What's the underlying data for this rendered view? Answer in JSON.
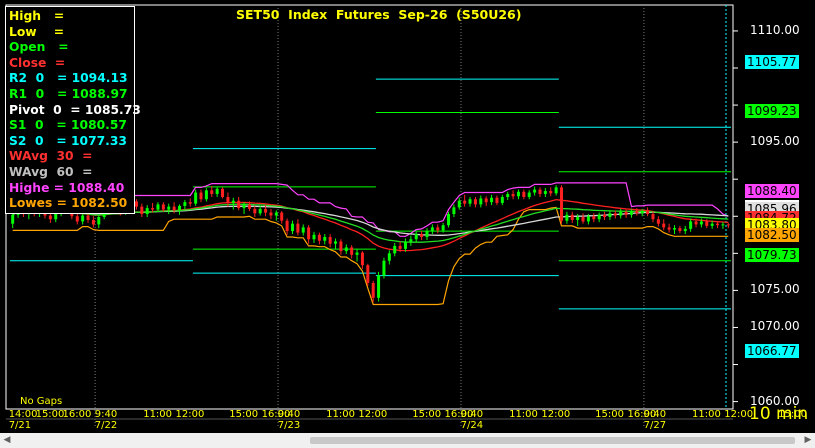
{
  "title": "SET50  Index  Futures  Sep-26  (S50U26)",
  "legend": [
    {
      "label": "High   =",
      "color": "#ffff00"
    },
    {
      "label": "Low    =",
      "color": "#ffff00"
    },
    {
      "label": "Open   =",
      "color": "#00ff00"
    },
    {
      "label": "Close  =",
      "color": "#ff3030"
    },
    {
      "label": "R2  0   = 1094.13",
      "color": "#00ffff"
    },
    {
      "label": "R1  0   = 1088.97",
      "color": "#00ff00"
    },
    {
      "label": "Pivot  0  = 1085.73",
      "color": "#ffffff"
    },
    {
      "label": "S1  0   = 1080.57",
      "color": "#00ff00"
    },
    {
      "label": "S2  0   = 1077.33",
      "color": "#00ffff"
    },
    {
      "label": "WAvg  30  =",
      "color": "#ff3030"
    },
    {
      "label": "WAvg  60  =",
      "color": "#c0c0c0"
    },
    {
      "label": "Highe = 1088.40",
      "color": "#ff44ff"
    },
    {
      "label": "Lowes = 1082.50",
      "color": "#ffa500"
    }
  ],
  "status": {
    "gaps": "No Gaps",
    "interval": "10  min"
  },
  "badges": [
    {
      "label": "1105.77",
      "value": 1105.77,
      "color": "#00ffff"
    },
    {
      "label": "1099.23",
      "value": 1099.23,
      "color": "#00ff00"
    },
    {
      "label": "1088.40",
      "value": 1088.4,
      "color": "#ff44ff"
    },
    {
      "label": "1086.27",
      "value": 1086.27,
      "color": "#ffffff"
    },
    {
      "label": "1085.96",
      "value": 1085.96,
      "color": "#e0e0e0"
    },
    {
      "label": "1084.72",
      "value": 1084.72,
      "color": "#ff3030"
    },
    {
      "label": "1083.80",
      "value": 1083.8,
      "color": "#ffff00"
    },
    {
      "label": "1082.50",
      "value": 1082.5,
      "color": "#ffa500"
    },
    {
      "label": "1079.73",
      "value": 1079.73,
      "color": "#00ff00"
    },
    {
      "label": "1066.77",
      "value": 1066.77,
      "color": "#00ffff"
    }
  ],
  "chart_data": {
    "type": "candlestick",
    "ylim": [
      1059,
      1113.5
    ],
    "yticks": [
      1060,
      1065,
      1070,
      1075,
      1080,
      1085,
      1090,
      1095,
      1100,
      1105,
      1110
    ],
    "ytick_labels": [
      "1060.00",
      "",
      "1070.00",
      "1075.00",
      "",
      "",
      "",
      "1095.00",
      "",
      "",
      "1110.00"
    ],
    "bars_per_day": 34,
    "days": [
      "7/21",
      "7/22",
      "7/23",
      "7/24",
      "7/27"
    ],
    "time_labels": [
      "14:00",
      "15:00",
      "16:00",
      "9:40",
      "11:00",
      "12:00",
      "15:00",
      "16:00",
      "9:40",
      "11:00",
      "12:00",
      "15:00",
      "16:00",
      "9:40",
      "11:00",
      "12:00",
      "15:00",
      "16:00",
      "9:40",
      "11:00",
      "12:00",
      "15:00"
    ],
    "time_label_bars": [
      0,
      5,
      10,
      16,
      25,
      31,
      41,
      47,
      50,
      59,
      65,
      75,
      81,
      84,
      93,
      99,
      109,
      115,
      118,
      127,
      133,
      143
    ],
    "date_label_bars": [
      0,
      16,
      50,
      84,
      118
    ],
    "pivot_levels": [
      {
        "name": "R2",
        "color": "#00ffff",
        "segments": [
          [
            null,
            1094.13
          ],
          [
            1094.13,
            1104.0
          ],
          [
            1103.5,
            1097.0
          ],
          [
            1097.0,
            1105.77
          ]
        ]
      },
      {
        "name": "R1",
        "color": "#00ff00",
        "segments": [
          [
            null,
            1088.97
          ],
          [
            1088.97,
            1099.0
          ],
          [
            1099.0,
            1091.0
          ],
          [
            1091.0,
            1099.23
          ]
        ]
      },
      {
        "name": "S1",
        "color": "#00ff00",
        "segments": [
          [
            null,
            1080.57
          ],
          [
            1080.57,
            1083.0
          ],
          [
            1083.0,
            1079.0
          ],
          [
            1079.0,
            1079.73
          ]
        ]
      },
      {
        "name": "S2",
        "color": "#00ffff",
        "segments": [
          [
            1079.0,
            1077.33
          ],
          [
            1077.33,
            1077.0
          ],
          [
            1077.0,
            1072.5
          ],
          [
            1072.5,
            1066.77
          ]
        ]
      }
    ],
    "candles": [
      [
        1084.0,
        1085.6,
        1083.4,
        1085.2
      ],
      [
        1085.2,
        1086.6,
        1084.8,
        1086.1
      ],
      [
        1086.1,
        1086.6,
        1084.9,
        1085.3
      ],
      [
        1085.3,
        1086.2,
        1084.6,
        1085.9
      ],
      [
        1085.9,
        1086.8,
        1085.0,
        1085.4
      ],
      [
        1085.4,
        1086.4,
        1084.9,
        1086.0
      ],
      [
        1086.0,
        1086.3,
        1084.7,
        1085.1
      ],
      [
        1085.1,
        1085.9,
        1084.1,
        1084.6
      ],
      [
        1084.6,
        1085.8,
        1084.2,
        1085.5
      ],
      [
        1085.5,
        1086.5,
        1085.0,
        1086.2
      ],
      [
        1086.2,
        1086.7,
        1085.4,
        1085.8
      ],
      [
        1085.8,
        1086.2,
        1084.6,
        1085.0
      ],
      [
        1085.0,
        1085.5,
        1083.9,
        1084.3
      ],
      [
        1084.3,
        1085.5,
        1083.9,
        1085.1
      ],
      [
        1085.1,
        1085.7,
        1084.1,
        1084.5
      ],
      [
        1084.5,
        1085.0,
        1083.5,
        1083.9
      ],
      [
        1083.9,
        1085.2,
        1083.4,
        1084.9
      ],
      [
        1084.9,
        1086.4,
        1084.6,
        1085.9
      ],
      [
        1085.9,
        1086.8,
        1085.4,
        1086.5
      ],
      [
        1086.5,
        1087.0,
        1085.6,
        1086.0
      ],
      [
        1086.0,
        1086.6,
        1085.1,
        1085.5
      ],
      [
        1085.5,
        1086.8,
        1085.2,
        1086.4
      ],
      [
        1086.4,
        1087.5,
        1086.0,
        1087.0
      ],
      [
        1087.0,
        1087.3,
        1085.9,
        1086.3
      ],
      [
        1086.3,
        1086.7,
        1084.9,
        1085.3
      ],
      [
        1085.3,
        1086.5,
        1084.9,
        1086.1
      ],
      [
        1086.1,
        1086.8,
        1085.5,
        1085.9
      ],
      [
        1085.9,
        1086.9,
        1085.6,
        1086.6
      ],
      [
        1086.6,
        1086.9,
        1085.6,
        1085.9
      ],
      [
        1085.9,
        1086.7,
        1085.3,
        1086.3
      ],
      [
        1086.3,
        1086.9,
        1085.4,
        1085.8
      ],
      [
        1085.8,
        1086.6,
        1085.2,
        1086.4
      ],
      [
        1086.4,
        1087.2,
        1085.9,
        1086.9
      ],
      [
        1086.9,
        1087.4,
        1086.3,
        1086.7
      ],
      [
        1086.7,
        1088.6,
        1086.4,
        1088.2
      ],
      [
        1088.2,
        1088.6,
        1086.9,
        1087.3
      ],
      [
        1087.3,
        1088.8,
        1087.0,
        1088.5
      ],
      [
        1088.5,
        1089.1,
        1087.6,
        1088.0
      ],
      [
        1088.0,
        1089.0,
        1087.6,
        1088.7
      ],
      [
        1088.7,
        1088.9,
        1087.4,
        1087.6
      ],
      [
        1087.6,
        1088.2,
        1086.3,
        1086.8
      ],
      [
        1086.8,
        1087.5,
        1085.9,
        1087.1
      ],
      [
        1087.1,
        1087.6,
        1085.8,
        1086.1
      ],
      [
        1086.1,
        1086.9,
        1085.3,
        1086.6
      ],
      [
        1086.6,
        1087.0,
        1085.7,
        1086.0
      ],
      [
        1086.0,
        1086.4,
        1084.9,
        1085.4
      ],
      [
        1085.4,
        1086.4,
        1085.1,
        1086.0
      ],
      [
        1086.0,
        1086.5,
        1085.0,
        1085.5
      ],
      [
        1085.5,
        1086.0,
        1084.6,
        1085.1
      ],
      [
        1085.1,
        1085.8,
        1084.4,
        1085.5
      ],
      [
        1085.5,
        1085.7,
        1084.0,
        1084.4
      ],
      [
        1084.4,
        1084.7,
        1082.5,
        1083.0
      ],
      [
        1083.0,
        1084.4,
        1082.6,
        1084.0
      ],
      [
        1084.0,
        1084.6,
        1082.4,
        1082.8
      ],
      [
        1082.8,
        1083.9,
        1082.4,
        1083.5
      ],
      [
        1083.5,
        1083.8,
        1081.3,
        1081.9
      ],
      [
        1081.9,
        1082.9,
        1081.4,
        1082.5
      ],
      [
        1082.5,
        1082.8,
        1081.2,
        1081.7
      ],
      [
        1081.7,
        1082.6,
        1081.2,
        1082.2
      ],
      [
        1082.2,
        1082.6,
        1080.8,
        1081.3
      ],
      [
        1081.3,
        1082.0,
        1080.5,
        1081.6
      ],
      [
        1081.6,
        1081.9,
        1079.8,
        1080.3
      ],
      [
        1080.3,
        1081.2,
        1079.9,
        1080.8
      ],
      [
        1080.8,
        1081.1,
        1079.3,
        1079.8
      ],
      [
        1079.8,
        1080.6,
        1078.9,
        1080.1
      ],
      [
        1080.1,
        1080.3,
        1077.9,
        1078.4
      ],
      [
        1078.4,
        1078.6,
        1075.6,
        1076.0
      ],
      [
        1076.0,
        1076.3,
        1073.4,
        1074.0
      ],
      [
        1074.0,
        1077.5,
        1073.5,
        1077.0
      ],
      [
        1077.0,
        1079.4,
        1076.6,
        1079.0
      ],
      [
        1079.0,
        1080.4,
        1078.5,
        1080.0
      ],
      [
        1080.0,
        1081.4,
        1079.6,
        1081.0
      ],
      [
        1081.0,
        1081.6,
        1080.2,
        1080.6
      ],
      [
        1080.6,
        1082.0,
        1080.2,
        1081.6
      ],
      [
        1081.6,
        1082.4,
        1081.0,
        1081.9
      ],
      [
        1081.9,
        1082.9,
        1081.5,
        1082.6
      ],
      [
        1082.6,
        1083.0,
        1081.8,
        1082.2
      ],
      [
        1082.2,
        1083.4,
        1081.8,
        1083.0
      ],
      [
        1083.0,
        1083.9,
        1082.6,
        1083.5
      ],
      [
        1083.5,
        1083.9,
        1082.7,
        1083.1
      ],
      [
        1083.1,
        1084.1,
        1082.8,
        1083.8
      ],
      [
        1083.8,
        1085.6,
        1083.5,
        1085.3
      ],
      [
        1085.3,
        1086.6,
        1084.9,
        1086.2
      ],
      [
        1086.2,
        1087.5,
        1085.9,
        1087.1
      ],
      [
        1087.1,
        1087.9,
        1086.3,
        1086.7
      ],
      [
        1086.7,
        1087.6,
        1086.3,
        1087.3
      ],
      [
        1087.3,
        1087.6,
        1086.2,
        1086.6
      ],
      [
        1086.6,
        1087.8,
        1086.2,
        1087.4
      ],
      [
        1087.4,
        1087.7,
        1086.4,
        1086.9
      ],
      [
        1086.9,
        1087.9,
        1086.5,
        1087.5
      ],
      [
        1087.5,
        1087.8,
        1086.5,
        1086.8
      ],
      [
        1086.8,
        1087.9,
        1086.5,
        1087.6
      ],
      [
        1087.6,
        1088.3,
        1087.2,
        1088.0
      ],
      [
        1088.0,
        1088.5,
        1087.3,
        1087.7
      ],
      [
        1087.7,
        1088.6,
        1087.3,
        1088.3
      ],
      [
        1088.3,
        1088.6,
        1087.3,
        1087.6
      ],
      [
        1087.6,
        1088.5,
        1087.3,
        1088.2
      ],
      [
        1088.2,
        1089.0,
        1087.8,
        1088.6
      ],
      [
        1088.6,
        1088.9,
        1087.6,
        1088.0
      ],
      [
        1088.0,
        1088.8,
        1087.6,
        1088.4
      ],
      [
        1088.4,
        1088.9,
        1087.7,
        1088.1
      ],
      [
        1088.1,
        1089.2,
        1087.8,
        1088.9
      ],
      [
        1088.9,
        1089.2,
        1084.0,
        1084.4
      ],
      [
        1084.4,
        1085.6,
        1084.0,
        1085.2
      ],
      [
        1085.2,
        1085.6,
        1084.1,
        1084.5
      ],
      [
        1084.5,
        1085.3,
        1083.7,
        1084.9
      ],
      [
        1084.9,
        1085.4,
        1084.0,
        1084.3
      ],
      [
        1084.3,
        1085.3,
        1083.9,
        1085.0
      ],
      [
        1085.0,
        1085.4,
        1084.2,
        1084.6
      ],
      [
        1084.6,
        1085.5,
        1084.2,
        1085.2
      ],
      [
        1085.2,
        1085.6,
        1084.5,
        1084.9
      ],
      [
        1084.9,
        1085.8,
        1084.5,
        1085.4
      ],
      [
        1085.4,
        1085.8,
        1084.7,
        1085.1
      ],
      [
        1085.1,
        1086.0,
        1084.7,
        1085.6
      ],
      [
        1085.6,
        1085.9,
        1084.8,
        1085.2
      ],
      [
        1085.2,
        1086.0,
        1084.8,
        1085.7
      ],
      [
        1085.7,
        1086.1,
        1085.1,
        1085.4
      ],
      [
        1085.4,
        1086.0,
        1085.0,
        1085.7
      ],
      [
        1085.7,
        1086.2,
        1085.0,
        1085.3
      ],
      [
        1085.3,
        1085.7,
        1084.2,
        1084.6
      ],
      [
        1084.6,
        1085.0,
        1083.6,
        1084.0
      ],
      [
        1084.0,
        1084.6,
        1083.1,
        1083.5
      ],
      [
        1083.5,
        1084.0,
        1082.8,
        1083.2
      ],
      [
        1083.2,
        1083.8,
        1082.6,
        1083.4
      ],
      [
        1083.4,
        1083.7,
        1082.7,
        1083.0
      ],
      [
        1083.0,
        1083.7,
        1082.6,
        1083.3
      ],
      [
        1083.3,
        1084.7,
        1082.9,
        1084.3
      ],
      [
        1084.3,
        1084.7,
        1083.5,
        1083.9
      ],
      [
        1083.9,
        1084.7,
        1083.5,
        1084.3
      ],
      [
        1084.3,
        1084.6,
        1083.4,
        1083.7
      ],
      [
        1083.7,
        1084.4,
        1083.3,
        1084.0
      ],
      [
        1084.0,
        1084.3,
        1083.4,
        1083.8
      ],
      [
        1083.8,
        1084.2,
        1083.3,
        1083.9
      ],
      [
        1083.9,
        1084.1,
        1083.4,
        1083.8
      ]
    ]
  }
}
